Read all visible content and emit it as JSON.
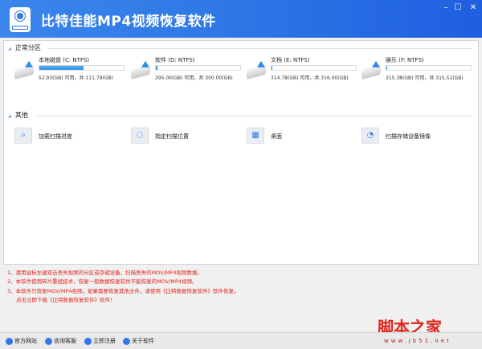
{
  "app": {
    "title": "比特佳能MP4视频恢复软件",
    "window_controls": {
      "minimize": "–",
      "maximize": "☐",
      "close": "✕"
    }
  },
  "sections": {
    "partitions": "正常分区",
    "others": "其他"
  },
  "drives": [
    {
      "name": "本地磁盘 (C: NTFS)",
      "capacity": "52.93(GB) 可用，共 111.79(GB)",
      "used_percent": 52.6
    },
    {
      "name": "软件 (D: NTFS)",
      "capacity": "295.00(GB) 可用，共 300.00(GB)",
      "used_percent": 1.7
    },
    {
      "name": "文档 (E: NTFS)",
      "capacity": "314.78(GB) 可用，共 316.00(GB)",
      "used_percent": 0.4
    },
    {
      "name": "娱乐 (F: NTFS)",
      "capacity": "315.38(GB) 可用，共 315.51(GB)",
      "used_percent": 0.04
    }
  ],
  "tools": [
    {
      "label": "加载扫描进度",
      "icon": "magnifier-icon"
    },
    {
      "label": "指定扫描位置",
      "icon": "folder-target-icon"
    },
    {
      "label": "桌面",
      "icon": "desktop-icon"
    },
    {
      "label": "扫描存储设备镜像",
      "icon": "disk-image-icon"
    }
  ],
  "notes": [
    "1、请用鼠标左键双击丢失视频的分区或存储设备，扫描丢失的MOV/MP4视频数据。",
    "2、本软件使用碎片重组技术，恢复一般数据恢复软件不能恢复的MOV/MP4视频。",
    "3、本软件只恢复MOV/MP4视频。如果需要恢复其他文件，请使用《比特数据恢复软件》软件恢复。",
    "点击立即下载《比特数据恢复软件》软件！"
  ],
  "footer": [
    "官方网站",
    "咨询客服",
    "立即注册",
    "关于软件"
  ],
  "watermark": {
    "text": "脚本之家",
    "url": "www.jb51.net"
  },
  "colors": {
    "accent": "#2f78e6",
    "notes": "#e2231a"
  }
}
